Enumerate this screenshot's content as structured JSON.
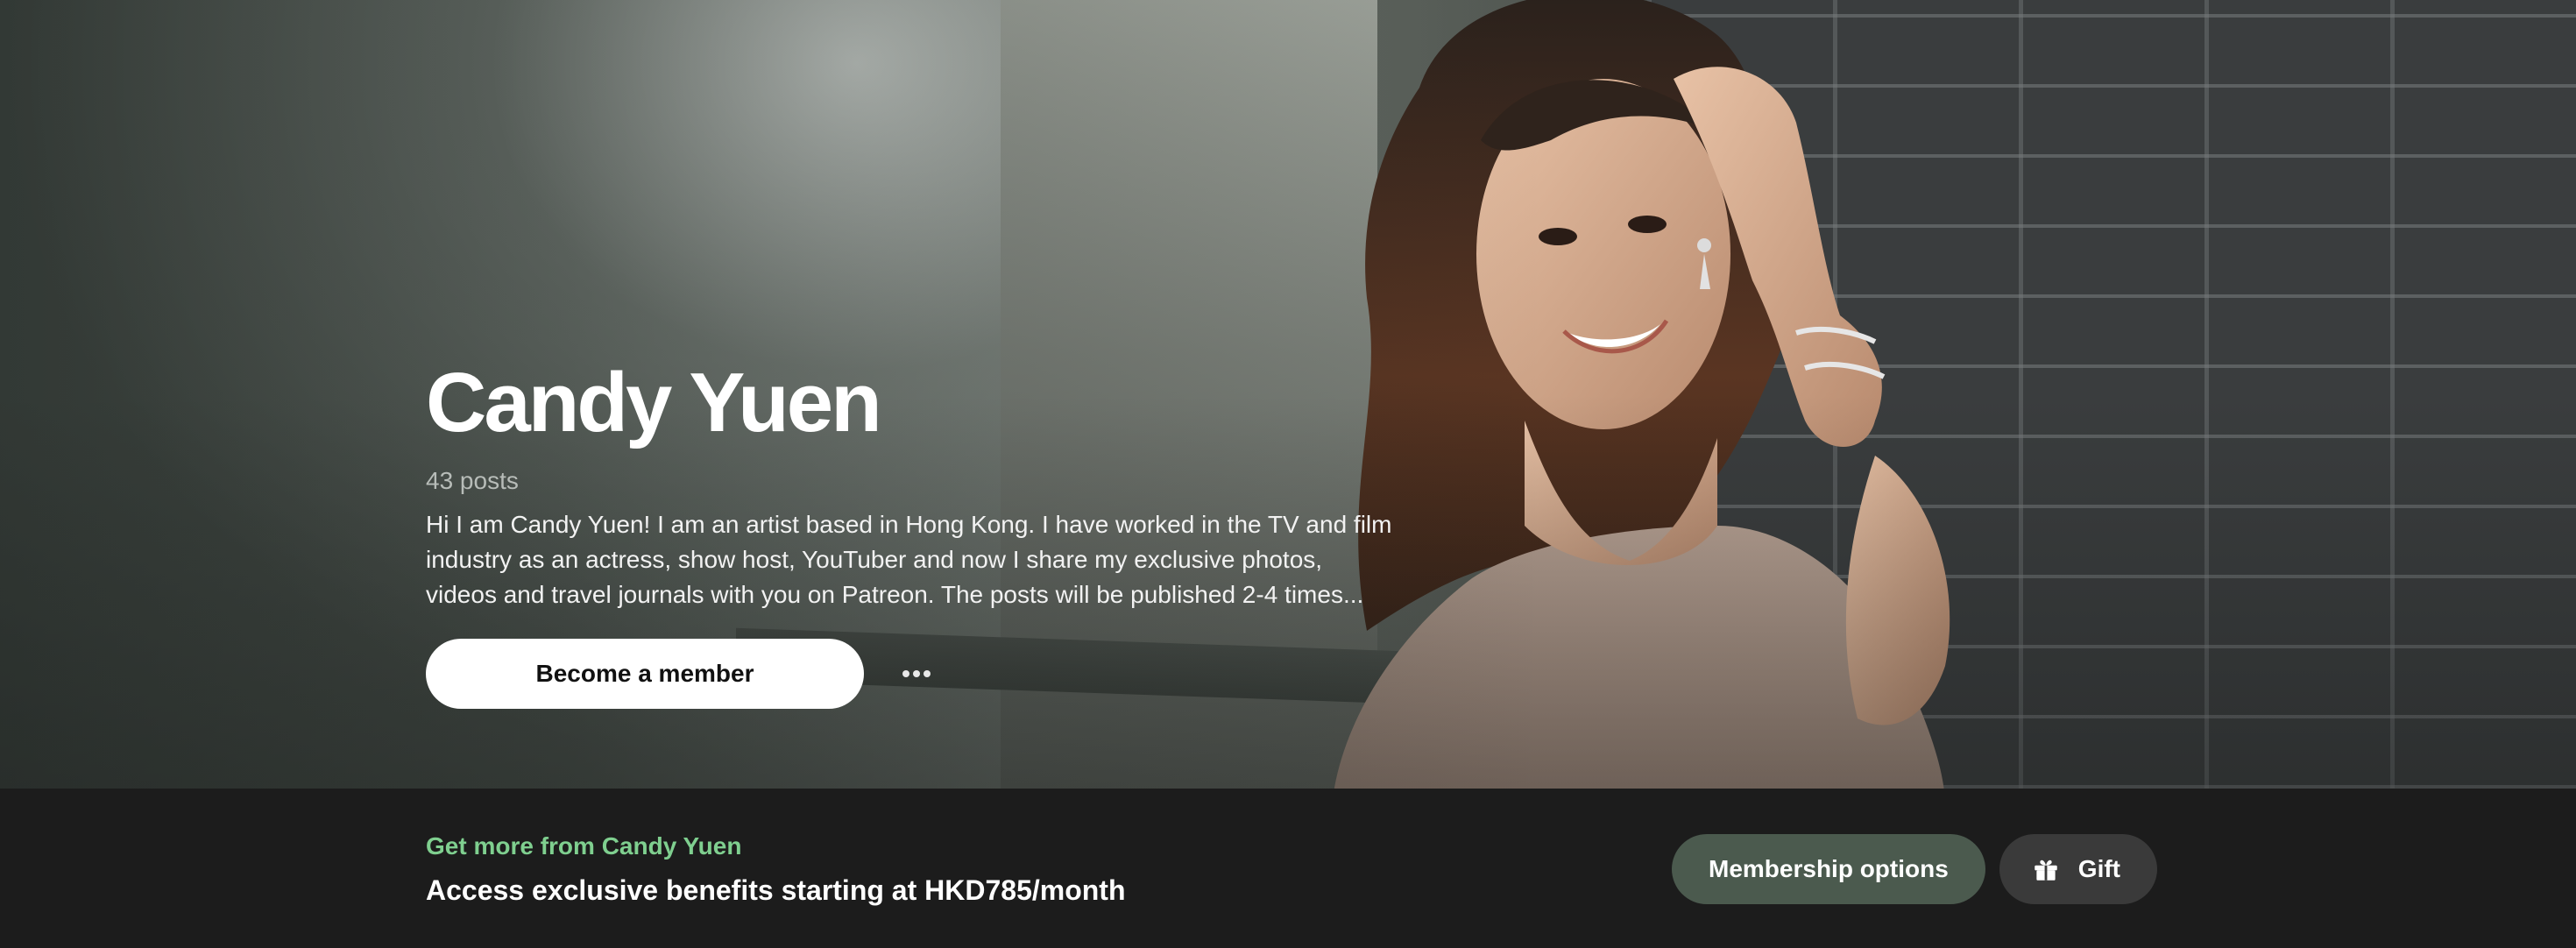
{
  "creator": {
    "name": "Candy Yuen",
    "post_count": "43 posts",
    "bio": "Hi I am Candy Yuen! I am an artist based in Hong Kong. I have worked in the TV and film industry as an actress, show host, YouTuber and now I share my exclusive photos, videos and travel journals with you on Patreon. The posts will be published 2-4 times..."
  },
  "actions": {
    "become_member_label": "Become a member",
    "more_icon": "more-horizontal-icon"
  },
  "promo": {
    "kicker": "Get more from Candy Yuen",
    "text": "Access exclusive benefits starting at HKD785/month"
  },
  "cta": {
    "membership_label": "Membership options",
    "gift_label": "Gift",
    "gift_icon": "gift-icon"
  },
  "colors": {
    "accent_green": "#7fcf8f",
    "membership_button": "#4b5a4e",
    "gift_button": "#3a3a3a",
    "bar_background": "#1c1c1c"
  }
}
